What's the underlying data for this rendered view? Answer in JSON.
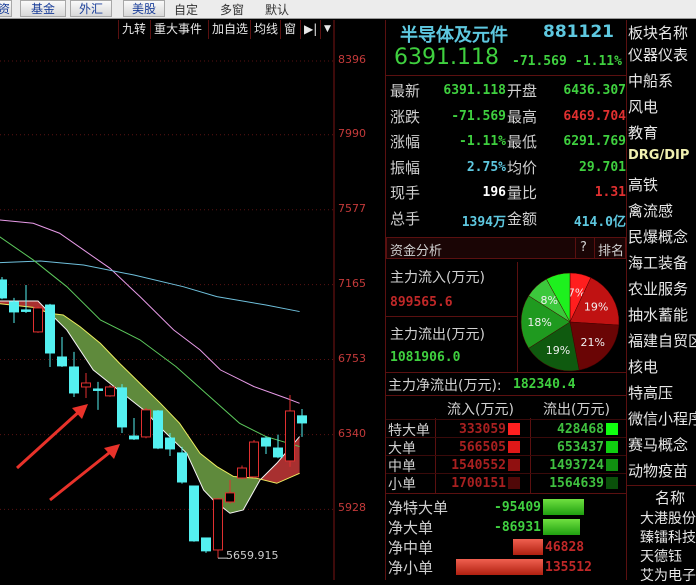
{
  "topbar": {
    "buttons": [
      "资",
      "基金",
      "外汇",
      "美股"
    ],
    "tabs": [
      "自定",
      "多窗",
      "默认"
    ]
  },
  "chart_toolbar": {
    "items": [
      "九转",
      "重大事件",
      "加自选",
      "均线",
      "窗"
    ],
    "arrow_icon": "skip-right-icon",
    "dropdown_icon": "triangle-down-icon"
  },
  "chart_data": {
    "type": "candlestick",
    "y_ticks": [
      8396,
      7990,
      7577,
      7165,
      6753,
      6340,
      5928
    ],
    "ylim": [
      5560,
      8480
    ],
    "low_annotation": "5659.915",
    "candles": [
      [
        7207,
        7191,
        7092,
        7085
      ],
      [
        7092,
        7070,
        7015,
        6954
      ],
      [
        7163,
        7026,
        7020,
        7009
      ],
      [
        7045,
        6905,
        7037,
        6900
      ],
      [
        7059,
        7053,
        6789,
        6712
      ],
      [
        6877,
        6767,
        6718,
        6712
      ],
      [
        6795,
        6712,
        6569,
        6547
      ],
      [
        6679,
        6602,
        6624,
        6541
      ],
      [
        6630,
        6591,
        6591,
        6476
      ],
      [
        6612,
        6553,
        6602,
        6548
      ],
      [
        6618,
        6597,
        6382,
        6349
      ],
      [
        6431,
        6332,
        6316,
        6310
      ],
      [
        6487,
        6327,
        6476,
        6320
      ],
      [
        6475,
        6470,
        6266,
        6260
      ],
      [
        6349,
        6321,
        6261,
        6222
      ],
      [
        6272,
        6239,
        6079,
        6070
      ],
      [
        6060,
        6057,
        5755,
        5750
      ],
      [
        5771,
        5771,
        5700,
        5689
      ],
      [
        5990,
        5705,
        5986,
        5660
      ],
      [
        6090,
        5969,
        6019,
        5960
      ],
      [
        6170,
        6101,
        6156,
        6095
      ],
      [
        6310,
        6107,
        6299,
        6100
      ],
      [
        6330,
        6321,
        6277,
        6233
      ],
      [
        6340,
        6266,
        6217,
        6210
      ],
      [
        6558,
        6195,
        6470,
        6162
      ],
      [
        6481,
        6443,
        6404,
        6327
      ]
    ],
    "ma_pink": [
      [
        -0.2,
        7521
      ],
      [
        2.6,
        7503
      ],
      [
        4.8,
        7448
      ],
      [
        6.8,
        7356
      ],
      [
        9,
        7255
      ],
      [
        11.5,
        7099
      ],
      [
        14.3,
        6916
      ],
      [
        16.5,
        6806
      ],
      [
        18.2,
        6696
      ],
      [
        21,
        6604
      ],
      [
        23.7,
        6540
      ],
      [
        24.8,
        6512
      ]
    ],
    "ma_blue": [
      [
        -0.2,
        7286
      ],
      [
        3.2,
        7295
      ],
      [
        6.8,
        7273
      ],
      [
        11,
        7218
      ],
      [
        15.1,
        7154
      ],
      [
        17.9,
        7099
      ],
      [
        22,
        7053
      ],
      [
        24.8,
        7017
      ]
    ],
    "ma_green": [
      [
        -0.2,
        7429
      ],
      [
        2.6,
        7301
      ],
      [
        5.4,
        7154
      ],
      [
        8.2,
        6971
      ],
      [
        11.5,
        6861
      ],
      [
        14.5,
        6714
      ],
      [
        17,
        6567
      ],
      [
        19.8,
        6402
      ],
      [
        22,
        6329
      ],
      [
        24.8,
        6274
      ]
    ],
    "band_a": [
      [
        -0.2,
        7075
      ],
      [
        3,
        7075
      ],
      [
        4,
        7007
      ],
      [
        5.4,
        6916
      ],
      [
        7.6,
        6696
      ],
      [
        9,
        6622
      ],
      [
        10.4,
        6549
      ],
      [
        11.8,
        6476
      ],
      [
        13.4,
        6365
      ],
      [
        15.4,
        6237
      ],
      [
        16.8,
        6035
      ],
      [
        17.6,
        5980
      ],
      [
        19,
        5907
      ],
      [
        20.1,
        5925
      ],
      [
        21.5,
        6090
      ],
      [
        22.9,
        6182
      ],
      [
        24.8,
        6329
      ]
    ],
    "band_b": [
      [
        -0.2,
        7060
      ],
      [
        2.6,
        7040
      ],
      [
        4,
        7007
      ],
      [
        5.1,
        6998
      ],
      [
        6.5,
        6934
      ],
      [
        8.2,
        6842
      ],
      [
        9.8,
        6732
      ],
      [
        11.5,
        6622
      ],
      [
        13.2,
        6512
      ],
      [
        14.8,
        6402
      ],
      [
        16.5,
        6237
      ],
      [
        17.9,
        6164
      ],
      [
        19.3,
        6109
      ],
      [
        21.2,
        6100
      ],
      [
        22.9,
        6072
      ],
      [
        24.8,
        6127
      ]
    ],
    "colors": {
      "up": "#e03030",
      "down": "#54f0f0",
      "pink": "#e89be8",
      "blue": "#6fc0dc",
      "green": "#5cc85c",
      "band_down": "#5f8a3c",
      "band_up": "#a83030"
    }
  },
  "quote": {
    "name": "半导体及元件",
    "code": "881121",
    "price": "6391.118",
    "change": "-71.569",
    "pct": "-1.11%",
    "rows": [
      {
        "l1": "最新",
        "v1": "6391.118",
        "c1": "g",
        "l2": "开盘",
        "v2": "6436.307",
        "c2": "g"
      },
      {
        "l1": "涨跌",
        "v1": "-71.569",
        "c1": "g",
        "l2": "最高",
        "v2": "6469.704",
        "c2": "r"
      },
      {
        "l1": "涨幅",
        "v1": "-1.11%",
        "c1": "g",
        "l2": "最低",
        "v2": "6291.769",
        "c2": "g"
      },
      {
        "l1": "振幅",
        "v1": "2.75%",
        "c1": "c",
        "l2": "均价",
        "v2": "29.701",
        "c2": "g"
      },
      {
        "l1": "现手",
        "v1": "196",
        "c1": "w",
        "l2": "量比",
        "v2": "1.31",
        "c2": "r"
      },
      {
        "l1": "总手",
        "v1": "1394万",
        "c1": "c",
        "l2": "金额",
        "v2": "414.0亿",
        "c2": "c"
      }
    ]
  },
  "fund": {
    "title": "资金分析",
    "help": "?",
    "rank": "排名",
    "in_label": "主力流入(万元)",
    "in_value": "899565.6",
    "out_label": "主力流出(万元)",
    "out_value": "1081906.0",
    "net_label": "主力净流出(万元):",
    "net_value": "182340.4",
    "pie": [
      {
        "v": 7,
        "label": "7%",
        "color": "#ff1e1e"
      },
      {
        "v": 19,
        "label": "19%",
        "color": "#c01212"
      },
      {
        "v": 21,
        "label": "21%",
        "color": "#6a0505"
      },
      {
        "v": 19,
        "label": "19%",
        "color": "#0f5a0f"
      },
      {
        "v": 18,
        "label": "18%",
        "color": "#1f9a1f"
      },
      {
        "v": 8,
        "label": "8%",
        "color": "#3cc83c"
      },
      {
        "v": 8,
        "label": "",
        "color": "#1ef01e"
      }
    ],
    "headers": [
      "流入(万元)",
      "流出(万元)"
    ],
    "flows": [
      {
        "name": "特大单",
        "in": "333059",
        "out": "428468",
        "inc": "#ff2020",
        "outc": "#10ff10"
      },
      {
        "name": "大单",
        "in": "566505",
        "out": "653437",
        "inc": "#e01818",
        "outc": "#10d010"
      },
      {
        "name": "中单",
        "in": "1540552",
        "out": "1493724",
        "inc": "#901010",
        "outc": "#109010"
      },
      {
        "name": "小单",
        "in": "1700151",
        "out": "1564639",
        "inc": "#500808",
        "outc": "#0a500a"
      }
    ],
    "net": [
      {
        "name": "净特大单",
        "value": "-95409",
        "amount": -95409
      },
      {
        "name": "净大单",
        "value": "-86931",
        "amount": -86931
      },
      {
        "name": "净中单",
        "value": "46828",
        "amount": 46828
      },
      {
        "name": "净小单",
        "value": "135512",
        "amount": 135512
      }
    ]
  },
  "sector_list": {
    "header": "板块名称",
    "items": [
      "仪器仪表",
      "中船系",
      "风电",
      "教育",
      "DRG/DIP",
      "高铁",
      "禽流感",
      "民爆概念",
      "海工装备",
      "农业服务",
      "抽水蓄能",
      "福建自贸区",
      "核电",
      "特高压",
      "微信小程序",
      "赛马概念",
      "动物疫苗"
    ],
    "highlight": "DRG/DIP"
  },
  "stock_list": {
    "header": "名称",
    "items": [
      "大港股份",
      "臻镭科技",
      "天德钰",
      "艾为电子"
    ]
  }
}
